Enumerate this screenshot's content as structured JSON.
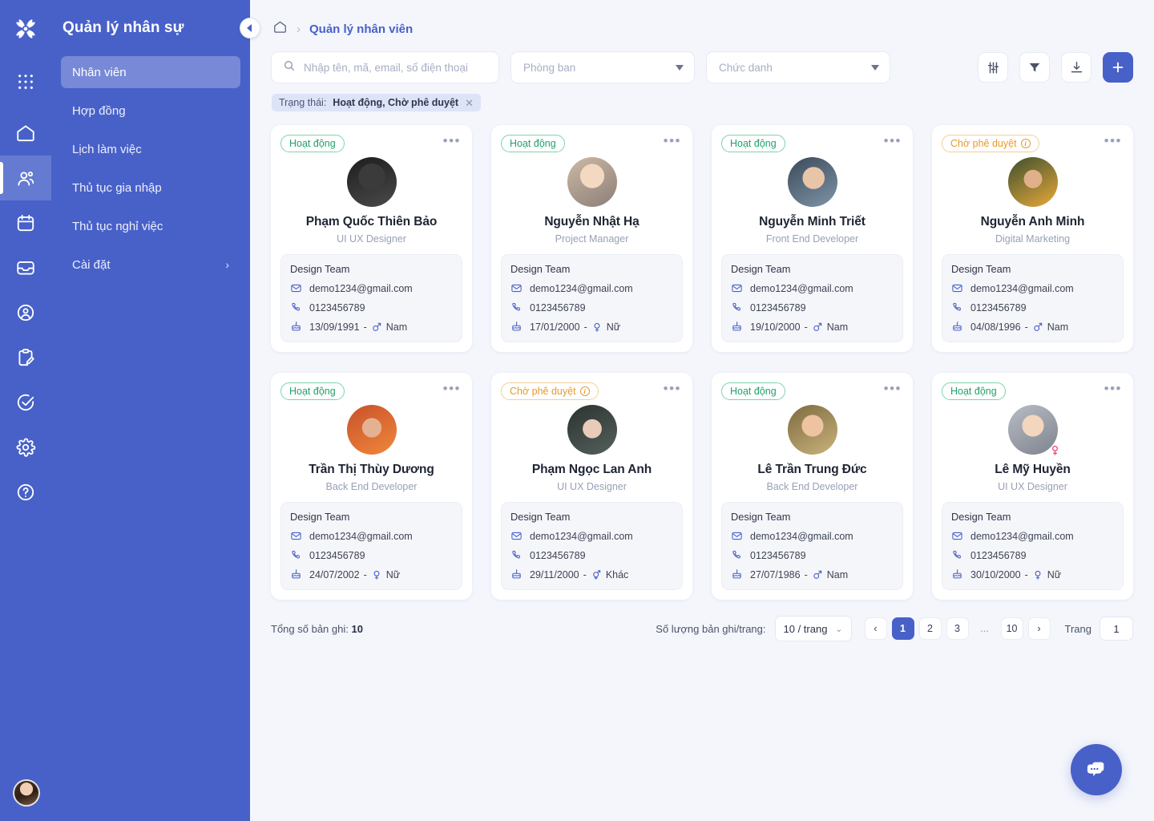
{
  "brand": {
    "logo_icon": "atom-logo-icon"
  },
  "sidebar": {
    "title": "Quản lý nhân sự",
    "items": [
      {
        "label": "Nhân viên",
        "active": true,
        "has_chevron": false
      },
      {
        "label": "Hợp đồng",
        "active": false,
        "has_chevron": false
      },
      {
        "label": "Lịch làm việc",
        "active": false,
        "has_chevron": false
      },
      {
        "label": "Thủ tục gia nhập",
        "active": false,
        "has_chevron": false
      },
      {
        "label": "Thủ tục nghỉ việc",
        "active": false,
        "has_chevron": false
      },
      {
        "label": "Cài đặt",
        "active": false,
        "has_chevron": true
      }
    ],
    "collapse_icon": "chevron-left-icon"
  },
  "rail": {
    "icons": [
      "apps-grid-icon",
      "home-icon",
      "people-icon",
      "calendar-icon",
      "inbox-icon",
      "user-circle-icon",
      "clipboard-edit-icon",
      "check-circle-icon",
      "gear-icon",
      "help-circle-icon"
    ],
    "active_index": 2,
    "avatar": "user-avatar"
  },
  "breadcrumb": {
    "home_icon": "home-icon",
    "separator": "›",
    "current": "Quản lý nhân viên"
  },
  "search": {
    "placeholder": "Nhập tên, mã, email, số điện thoại",
    "value": "",
    "icon": "search-icon"
  },
  "filters": {
    "department": {
      "placeholder": "Phòng ban",
      "value": ""
    },
    "job_title": {
      "placeholder": "Chức danh",
      "value": ""
    }
  },
  "toolbar_buttons": [
    {
      "name": "settings-sliders-icon"
    },
    {
      "name": "filter-funnel-icon"
    },
    {
      "name": "download-icon"
    },
    {
      "name": "add-plus-icon"
    }
  ],
  "chip": {
    "prefix": "Trạng thái:",
    "value": "Hoạt động, Chờ phê duyệt",
    "close_icon": "close-icon"
  },
  "status_labels": {
    "active": "Hoạt động",
    "pending": "Chờ phê duyệt"
  },
  "colors": {
    "brand": "#4861c9",
    "active_green": "#22a06b",
    "pending_orange": "#e79a2b",
    "page_bg": "#f4f6fc",
    "gender_pink": "#ee4b8b"
  },
  "employees": [
    {
      "status": "active",
      "name": "Phạm Quốc Thiên Bảo",
      "role": "UI UX Designer",
      "team": "Design Team",
      "email": "demo1234@gmail.com",
      "phone": "0123456789",
      "birthday": "13/09/1991",
      "gender": "Nam",
      "gender_symbol": "male",
      "avatar_style": "a1",
      "pin": false
    },
    {
      "status": "active",
      "name": "Nguyễn Nhật Hạ",
      "role": "Project Manager",
      "team": "Design Team",
      "email": "demo1234@gmail.com",
      "phone": "0123456789",
      "birthday": "17/01/2000",
      "gender": "Nữ",
      "gender_symbol": "female",
      "avatar_style": "a2",
      "pin": false
    },
    {
      "status": "active",
      "name": "Nguyễn Minh Triết",
      "role": "Front End Developer",
      "team": "Design Team",
      "email": "demo1234@gmail.com",
      "phone": "0123456789",
      "birthday": "19/10/2000",
      "gender": "Nam",
      "gender_symbol": "male",
      "avatar_style": "a3",
      "pin": false
    },
    {
      "status": "pending",
      "name": "Nguyễn Anh Minh",
      "role": "Digital Marketing",
      "team": "Design Team",
      "email": "demo1234@gmail.com",
      "phone": "0123456789",
      "birthday": "04/08/1996",
      "gender": "Nam",
      "gender_symbol": "male",
      "avatar_style": "a4",
      "pin": false
    },
    {
      "status": "active",
      "name": "Trần Thị Thùy Dương",
      "role": "Back End Developer",
      "team": "Design Team",
      "email": "demo1234@gmail.com",
      "phone": "0123456789",
      "birthday": "24/07/2002",
      "gender": "Nữ",
      "gender_symbol": "female",
      "avatar_style": "a5",
      "pin": false
    },
    {
      "status": "pending",
      "name": "Phạm Ngọc Lan Anh",
      "role": "UI UX Designer",
      "team": "Design Team",
      "email": "demo1234@gmail.com",
      "phone": "0123456789",
      "birthday": "29/11/2000",
      "gender": "Khác",
      "gender_symbol": "other",
      "avatar_style": "a6",
      "pin": false
    },
    {
      "status": "active",
      "name": "Lê Trần Trung Đức",
      "role": "Back End Developer",
      "team": "Design Team",
      "email": "demo1234@gmail.com",
      "phone": "0123456789",
      "birthday": "27/07/1986",
      "gender": "Nam",
      "gender_symbol": "male",
      "avatar_style": "a7",
      "pin": false
    },
    {
      "status": "active",
      "name": "Lê Mỹ Huyền",
      "role": "UI UX Designer",
      "team": "Design Team",
      "email": "demo1234@gmail.com",
      "phone": "0123456789",
      "birthday": "30/10/2000",
      "gender": "Nữ",
      "gender_symbol": "female",
      "avatar_style": "a8",
      "pin": true
    }
  ],
  "footer": {
    "total_label": "Tổng số bản ghi:",
    "total_value": "10",
    "per_page_label": "Số lượng bản ghi/trang:",
    "per_page_value": "10 / trang",
    "pages": [
      "1",
      "2",
      "3",
      "...",
      "10"
    ],
    "current_page": "1",
    "prev_icon": "chevron-left-icon",
    "next_icon": "chevron-right-icon",
    "page_label": "Trang",
    "page_input_value": "1"
  },
  "fab": {
    "icon": "chat-bubble-icon"
  }
}
